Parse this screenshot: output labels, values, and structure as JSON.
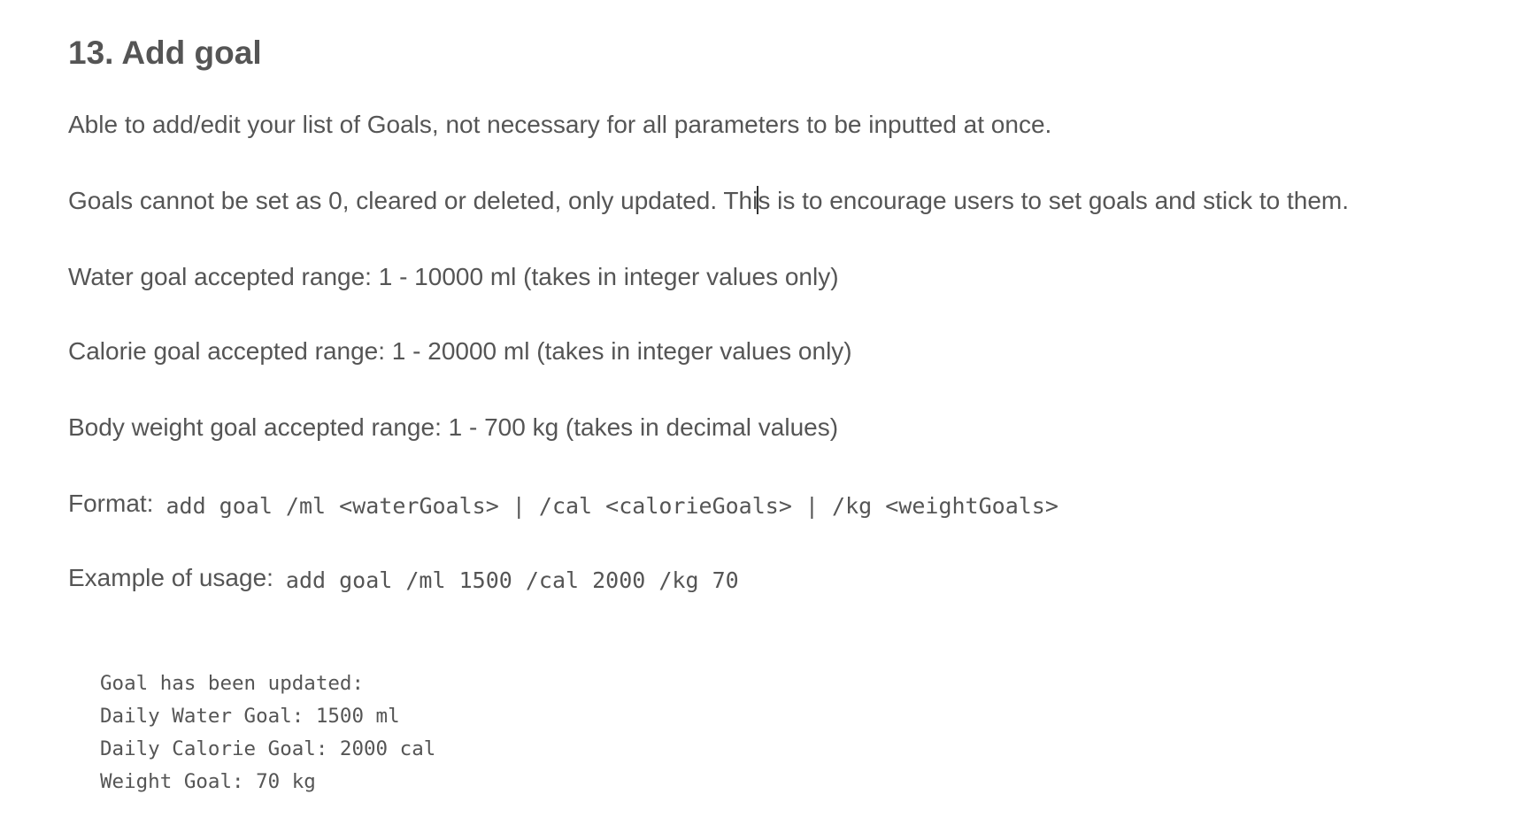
{
  "section": {
    "heading": "13. Add goal"
  },
  "paragraphs": {
    "intro": "Able to add/edit your list of Goals, not necessary for all parameters to be inputted at once.",
    "rule_before_caret": "Goals cannot be set as 0, cleared or deleted, only updated. Thi",
    "rule_after_caret": "s is to encourage users to set goals and stick to them.",
    "water_range": "Water goal accepted range: 1 - 10000 ml (takes in integer values only)",
    "calorie_range": "Calorie goal accepted range: 1 - 20000 ml (takes in integer values only)",
    "weight_range": "Body weight goal accepted range: 1 - 700 kg (takes in decimal values)"
  },
  "format": {
    "label": "Format:",
    "code": "add goal /ml <waterGoals> | /cal <calorieGoals> | /kg <weightGoals>"
  },
  "example": {
    "label": "Example of usage:",
    "code": "add goal /ml 1500 /cal 2000 /kg 70"
  },
  "output": {
    "lines": [
      "Goal has been updated:",
      "Daily Water Goal: 1500 ml",
      "Daily Calorie Goal: 2000 cal",
      "Weight Goal: 70 kg"
    ]
  }
}
